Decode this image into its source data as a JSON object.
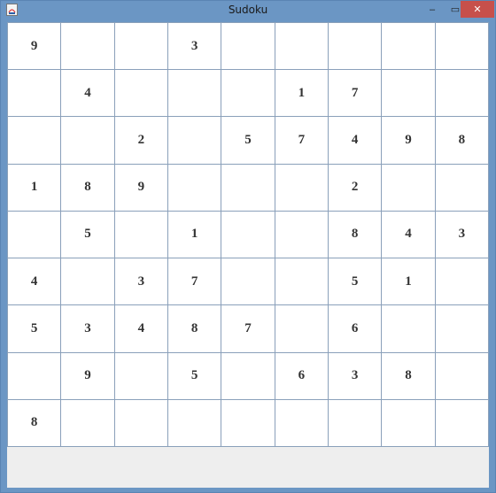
{
  "window": {
    "title": "Sudoku"
  },
  "controls": {
    "minimize": "–",
    "maximize": "▭",
    "close": "✕"
  },
  "grid": [
    [
      "9",
      "",
      "",
      "3",
      "",
      "",
      "",
      "",
      ""
    ],
    [
      "",
      "4",
      "",
      "",
      "",
      "1",
      "7",
      "",
      ""
    ],
    [
      "",
      "",
      "2",
      "",
      "5",
      "7",
      "4",
      "9",
      "8"
    ],
    [
      "1",
      "8",
      "9",
      "",
      "",
      "",
      "2",
      "",
      ""
    ],
    [
      "",
      "5",
      "",
      "1",
      "",
      "",
      "8",
      "4",
      "3"
    ],
    [
      "4",
      "",
      "3",
      "7",
      "",
      "",
      "5",
      "1",
      ""
    ],
    [
      "5",
      "3",
      "4",
      "8",
      "7",
      "",
      "6",
      "",
      ""
    ],
    [
      "",
      "9",
      "",
      "5",
      "",
      "6",
      "3",
      "8",
      ""
    ],
    [
      "8",
      "",
      "",
      "",
      "",
      "",
      "",
      "",
      ""
    ]
  ]
}
